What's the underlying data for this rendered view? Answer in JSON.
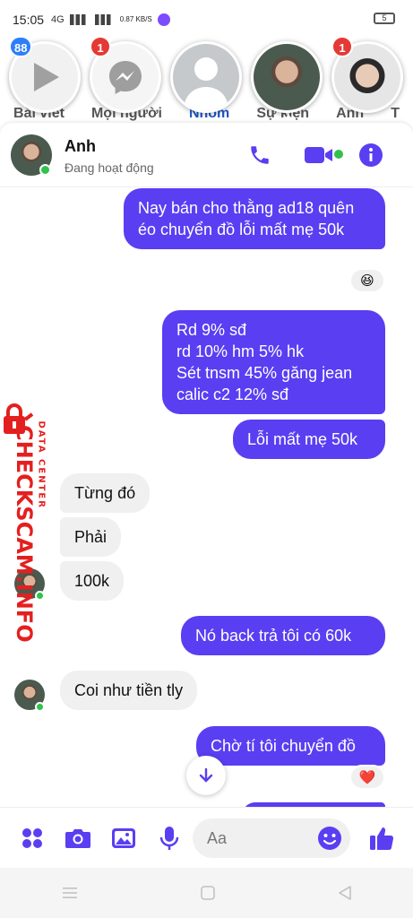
{
  "status_bar": {
    "time": "15:05",
    "network": "4G",
    "speed": "0.87 KB/S",
    "battery": "5"
  },
  "background_tabs": [
    "Bài viết",
    "Mọi người",
    "Nhóm",
    "Sự kiện",
    "Anh",
    "T"
  ],
  "chat_heads": [
    {
      "name": "video-head",
      "badge": "88"
    },
    {
      "name": "messenger-head",
      "badge": "1"
    },
    {
      "name": "blank-profile-head",
      "badge": ""
    },
    {
      "name": "anh-head",
      "badge": ""
    },
    {
      "name": "boy-head",
      "badge": "1"
    }
  ],
  "header": {
    "contact_name": "Anh",
    "status": "Đang hoạt động"
  },
  "messages": {
    "m1": "Nay bán cho thằng ad18 quên éo chuyển đồ lỗi mất mẹ 50k",
    "m1_reaction": "😆",
    "m2": "Rd 9% sđ\nrd 10% hm 5% hk\nSét tnsm 45% găng jean\ncalic c2 12% sđ",
    "m3": "Lỗi mất mẹ 50k",
    "m4": "Từng đó",
    "m5": "Phải",
    "m6": "100k",
    "m7": "Nó back trả tôi có 60k",
    "m8": "Coi như tiền tly",
    "m9": "Chờ tí tôi chuyển đồ",
    "m9_reaction": "❤️"
  },
  "watermark": {
    "line1": "CHECKSCAM.INFO",
    "line2": "DATA CENTER"
  },
  "composer": {
    "placeholder": "Aa"
  },
  "colors": {
    "accent": "#5a3ef2",
    "online": "#31c24d",
    "badge": "#e53935",
    "incoming": "#f0f0f0"
  }
}
